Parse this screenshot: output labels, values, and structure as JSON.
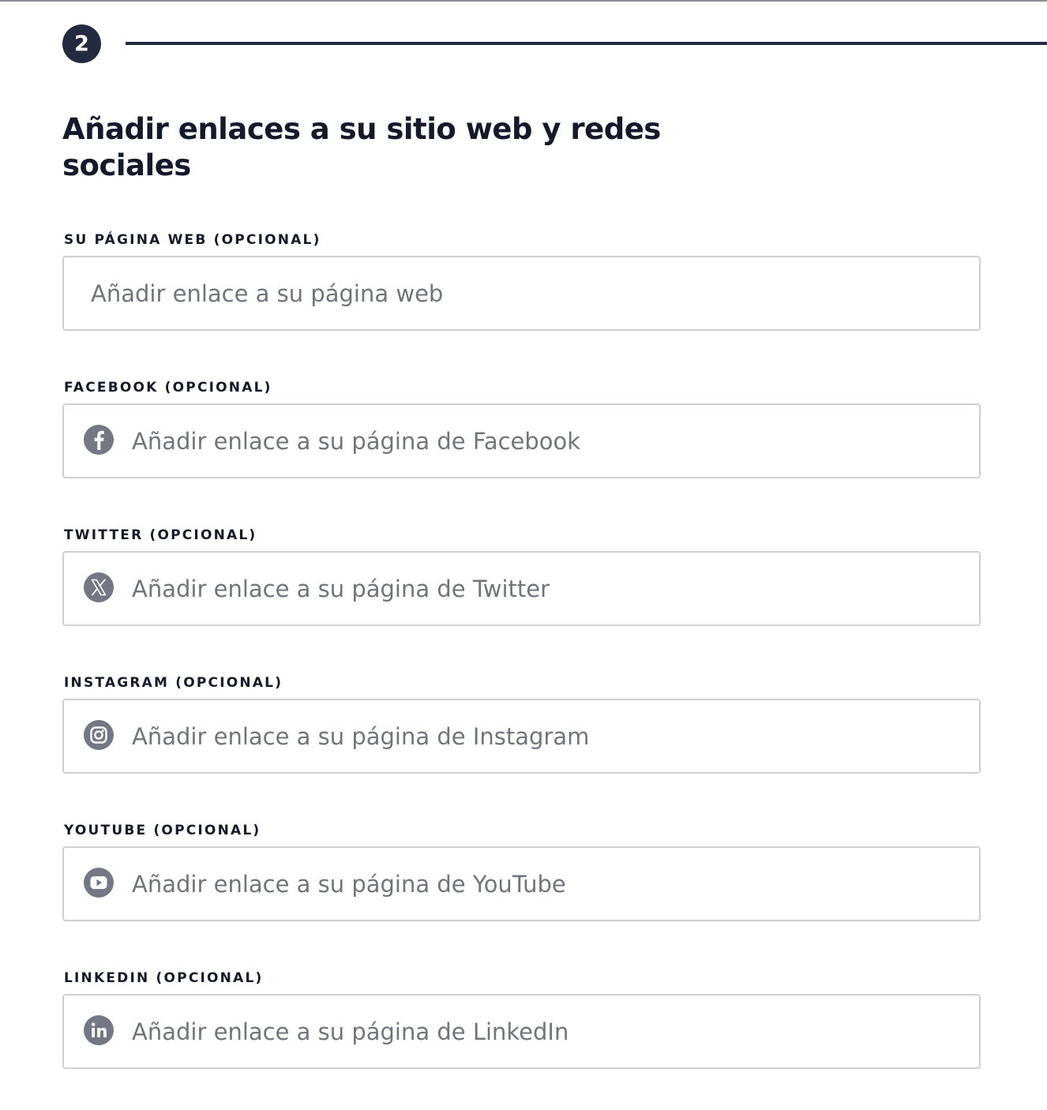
{
  "step": {
    "number": "2"
  },
  "section": {
    "title": "Añadir enlaces a su sitio web y redes sociales"
  },
  "colors": {
    "badge": "#242b40",
    "title_text": "#14192b",
    "placeholder": "#70747d",
    "icon": "#737884",
    "input_border": "#cfd0d4"
  },
  "fields": [
    {
      "label": "SU PÁGINA WEB (OPCIONAL)",
      "placeholder": "Añadir enlace a su página web",
      "value": "",
      "icon": null
    },
    {
      "label": "FACEBOOK (OPCIONAL)",
      "placeholder": "Añadir enlace a su página de Facebook",
      "value": "",
      "icon": "facebook-icon"
    },
    {
      "label": "TWITTER (OPCIONAL)",
      "placeholder": "Añadir enlace a su página de Twitter",
      "value": "",
      "icon": "x-twitter-icon"
    },
    {
      "label": "INSTAGRAM (OPCIONAL)",
      "placeholder": "Añadir enlace a su página de Instagram",
      "value": "",
      "icon": "instagram-icon"
    },
    {
      "label": "YOUTUBE (OPCIONAL)",
      "placeholder": "Añadir enlace a su página de YouTube",
      "value": "",
      "icon": "youtube-icon"
    },
    {
      "label": "LINKEDIN (OPCIONAL)",
      "placeholder": "Añadir enlace a su página de LinkedIn",
      "value": "",
      "icon": "linkedin-icon"
    }
  ]
}
